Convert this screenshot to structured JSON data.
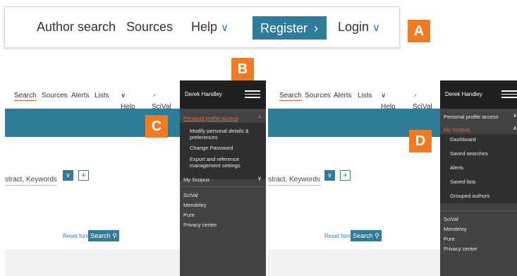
{
  "topbar": {
    "author_search": "Author search",
    "sources": "Sources",
    "help": "Help",
    "register": "Register",
    "login": "Login"
  },
  "badges": {
    "a": "A",
    "b": "B",
    "c": "C",
    "d": "D"
  },
  "nav": {
    "search": "Search",
    "sources": "Sources",
    "alerts": "Alerts",
    "lists": "Lists",
    "help": "Help",
    "scival": "SciVal"
  },
  "search_form": {
    "field_text": "stract, Keywords",
    "reset": "Reset form",
    "search": "Search"
  },
  "drawer": {
    "user": "Derek Handley",
    "personal_profile_access": "Personal profile access",
    "modify_personal_details": "Modify personal details &",
    "modify_personal_details_2": "preferences",
    "change_password": "Change Password",
    "export_reference": "Export and reference",
    "export_reference_2": "management settings",
    "my_scopus": "My Scopus",
    "dashboard": "Dashboard",
    "saved_searches": "Saved searches",
    "alerts": "Alerts",
    "saved_lists": "Saved lists",
    "grouped_authors": "Grouped authors",
    "scival": "SciVal",
    "mendeley": "Mendeley",
    "pure": "Pure",
    "privacy_center": "Privacy center"
  },
  "colors": {
    "brand_teal": "#2f7c99",
    "accent_orange": "#f07b23",
    "link_blue": "#2e7bb8"
  }
}
